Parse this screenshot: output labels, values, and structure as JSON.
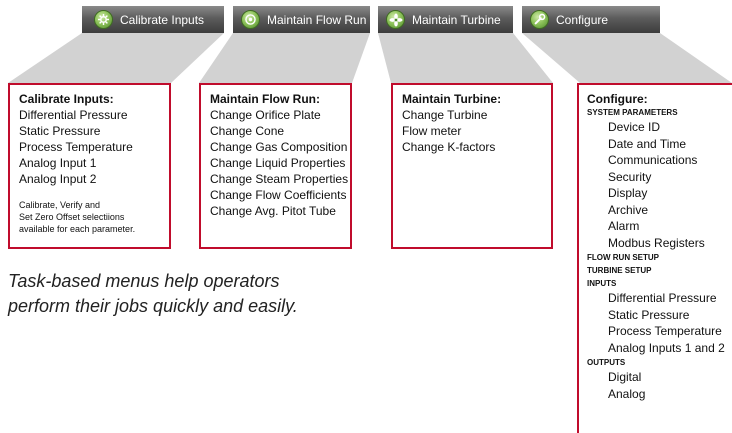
{
  "colors": {
    "panel_border": "#c00c2c",
    "tab_bg": "#4a4a4a",
    "funnel": "#d2d2d2",
    "icon": "#8ec35b"
  },
  "tabs": [
    {
      "label": "Calibrate Inputs",
      "icon": "gear-icon"
    },
    {
      "label": "Maintain Flow Run",
      "icon": "gauge-icon"
    },
    {
      "label": "Maintain Turbine",
      "icon": "fan-icon"
    },
    {
      "label": "Configure",
      "icon": "wrench-icon"
    }
  ],
  "panels": {
    "calibrate": {
      "title": "Calibrate Inputs:",
      "items": [
        "Differential Pressure",
        "Static Pressure",
        "Process Temperature",
        "Analog Input 1",
        "Analog Input 2"
      ],
      "note": [
        "Calibrate, Verify and",
        "Set Zero Offset selectiions",
        "available for each parameter."
      ]
    },
    "flow_run": {
      "title": "Maintain Flow Run:",
      "items": [
        "Change Orifice Plate",
        "Change Cone",
        "Change Gas Composition",
        "Change Liquid Properties",
        "Change Steam Properties",
        "Change Flow Coefficients",
        "Change Avg. Pitot Tube"
      ]
    },
    "turbine": {
      "title": "Maintain Turbine:",
      "items": [
        "Change Turbine",
        "Flow meter",
        "Change K-factors"
      ]
    },
    "configure": {
      "title": "Configure:",
      "sections": [
        {
          "label": "SYSTEM PARAMETERS",
          "items": [
            "Device ID",
            "Date and Time",
            "Communications",
            "Security",
            "Display",
            "Archive",
            "Alarm",
            "Modbus Registers"
          ]
        },
        {
          "label": "FLOW RUN SETUP",
          "items": []
        },
        {
          "label": "TURBINE SETUP",
          "items": []
        },
        {
          "label": "INPUTS",
          "items": [
            "Differential Pressure",
            "Static Pressure",
            "Process Temperature",
            "Analog Inputs 1 and 2"
          ]
        },
        {
          "label": "OUTPUTS",
          "items": [
            "Digital",
            "Analog"
          ]
        }
      ]
    }
  },
  "tagline": [
    "Task-based menus help operators",
    "perform their jobs quickly and easily."
  ]
}
